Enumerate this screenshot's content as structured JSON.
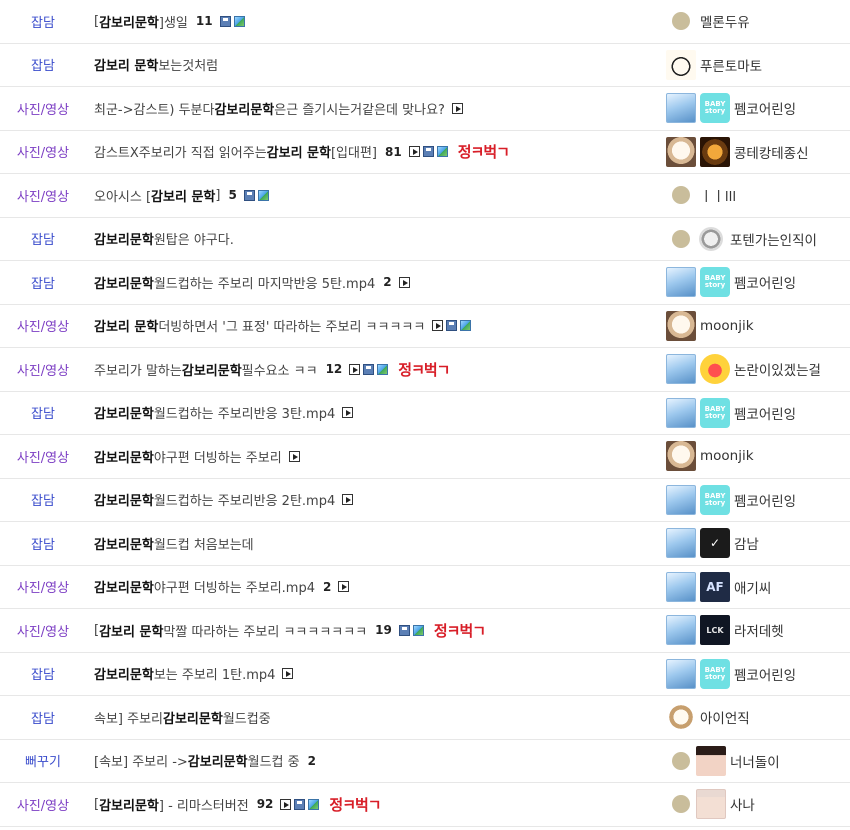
{
  "colors": {
    "category_talk": "#3b4dcc",
    "category_media": "#7d3fc4",
    "badge": "#d81e28"
  },
  "rows": [
    {
      "category": "잡담",
      "pre": "[",
      "bold": "감보리문학",
      "post": "]생일",
      "comments": "11",
      "icons": [
        "disk",
        "image"
      ],
      "badge": "",
      "author": "멜론두유"
    },
    {
      "category": "잡담",
      "pre": "",
      "bold": "감보리 문학",
      "post": " 보는것처럼",
      "comments": "",
      "icons": [],
      "badge": "",
      "author": "푸른토마토"
    },
    {
      "category": "사진/영상",
      "pre": "최군->감스트) 두분다 ",
      "bold": "감보리문학",
      "post": " 은근 즐기시는거같은데 맞나요?",
      "comments": "",
      "icons": [
        "video"
      ],
      "badge": "",
      "author": "펨코어린잉"
    },
    {
      "category": "사진/영상",
      "pre": "감스트X주보리가 직접 읽어주는 ",
      "bold": "감보리 문학",
      "post": " [입대편]",
      "comments": "81",
      "icons": [
        "video",
        "disk",
        "image"
      ],
      "badge": "정ㅋ벅ㄱ",
      "author": "콩테캉테종신"
    },
    {
      "category": "사진/영상",
      "pre": "오아시스 [",
      "bold": "감보리 문학",
      "post": "]",
      "comments": "5",
      "icons": [
        "disk",
        "image"
      ],
      "badge": "",
      "author": "ㅣㅣlll"
    },
    {
      "category": "잡담",
      "pre": "",
      "bold": "감보리문학",
      "post": " 원탑은 야구다.",
      "comments": "",
      "icons": [],
      "badge": "",
      "author": "포텐가는인직이"
    },
    {
      "category": "잡담",
      "pre": "",
      "bold": "감보리문학",
      "post": " 월드컵하는 주보리 마지막반응 5탄.mp4",
      "comments": "2",
      "icons": [
        "video"
      ],
      "badge": "",
      "author": "펨코어린잉"
    },
    {
      "category": "사진/영상",
      "pre": "",
      "bold": "감보리 문학",
      "post": " 더빙하면서 '그 표정' 따라하는 주보리 ㅋㅋㅋㅋㅋ",
      "comments": "",
      "icons": [
        "video",
        "disk",
        "image"
      ],
      "badge": "",
      "author": "moonjik"
    },
    {
      "category": "사진/영상",
      "pre": "주보리가 말하는 ",
      "bold": "감보리문학",
      "post": " 필수요소 ㅋㅋ",
      "comments": "12",
      "icons": [
        "video",
        "disk",
        "image"
      ],
      "badge": "정ㅋ벅ㄱ",
      "author": "논란이있겠는걸"
    },
    {
      "category": "잡담",
      "pre": "",
      "bold": "감보리문학",
      "post": " 월드컵하는 주보리반응 3탄.mp4",
      "comments": "",
      "icons": [
        "video"
      ],
      "badge": "",
      "author": "펨코어린잉"
    },
    {
      "category": "사진/영상",
      "pre": "",
      "bold": "감보리문학",
      "post": " 야구편 더빙하는 주보리",
      "comments": "",
      "icons": [
        "video"
      ],
      "badge": "",
      "author": "moonjik"
    },
    {
      "category": "잡담",
      "pre": "",
      "bold": "감보리문학",
      "post": " 월드컵하는 주보리반응 2탄.mp4",
      "comments": "",
      "icons": [
        "video"
      ],
      "badge": "",
      "author": "펨코어린잉"
    },
    {
      "category": "잡담",
      "pre": "",
      "bold": "감보리문학",
      "post": " 월드컵 처음보는데",
      "comments": "",
      "icons": [],
      "badge": "",
      "author": "감남"
    },
    {
      "category": "사진/영상",
      "pre": "",
      "bold": "감보리문학",
      "post": " 야구편 더빙하는 주보리.mp4",
      "comments": "2",
      "icons": [
        "video"
      ],
      "badge": "",
      "author": "애기씨"
    },
    {
      "category": "사진/영상",
      "pre": "[",
      "bold": "감보리 문학",
      "post": " 막짤 따라하는 주보리 ㅋㅋㅋㅋㅋㅋㅋ",
      "comments": "19",
      "icons": [
        "disk",
        "image"
      ],
      "badge": "정ㅋ벅ㄱ",
      "author": "라저데헷"
    },
    {
      "category": "잡담",
      "pre": "",
      "bold": "감보리문학",
      "post": "보는 주보리 1탄.mp4",
      "comments": "",
      "icons": [
        "video"
      ],
      "badge": "",
      "author": "펨코어린잉"
    },
    {
      "category": "잡담",
      "pre": "속보] 주보리 ",
      "bold": "감보리문학",
      "post": " 월드컵중",
      "comments": "",
      "icons": [],
      "badge": "",
      "author": "아이언직"
    },
    {
      "category": "뻐꾸기",
      "pre": "[속보] 주보리 -> ",
      "bold": "감보리문학",
      "post": " 월드컵 중",
      "comments": "2",
      "icons": [],
      "badge": "",
      "author": "너너돌이"
    },
    {
      "category": "사진/영상",
      "pre": "[",
      "bold": "감보리문학",
      "post": "] - 리마스터버전",
      "comments": "92",
      "icons": [
        "video",
        "disk",
        "image"
      ],
      "badge": "정ㅋ벅ㄱ",
      "author": "사나"
    }
  ]
}
